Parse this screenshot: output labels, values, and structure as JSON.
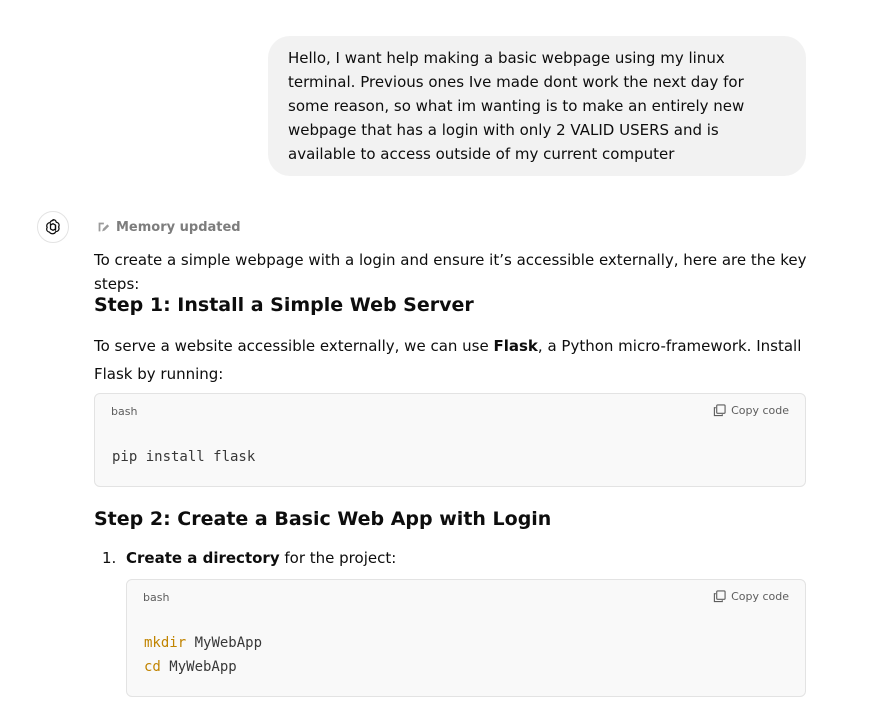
{
  "user_message": {
    "text": "Hello, I want help making a basic webpage using my linux terminal. Previous ones Ive made dont work the next day for some reason, so what im wanting is to make an entirely new webpage that has a login with only 2 VALID USERS and is available to access outside of my current computer"
  },
  "assistant": {
    "memory_label": "Memory updated",
    "intro": "To create a simple webpage with a login and ensure it’s accessible externally, here are the key steps:",
    "step1": {
      "heading": "Step 1: Install a Simple Web Server",
      "para_before": "To serve a website accessible externally, we can use ",
      "para_bold": "Flask",
      "para_after": ", a Python micro-framework. Install Flask by running:",
      "code": {
        "language": "bash",
        "copy_label": "Copy code",
        "line1": "pip install flask"
      }
    },
    "step2": {
      "heading": "Step 2: Create a Basic Web App with Login",
      "item1": {
        "number": "1.",
        "bold": "Create a directory",
        "rest": " for the project:"
      },
      "code": {
        "language": "bash",
        "copy_label": "Copy code",
        "line1_cmd": "mkdir",
        "line1_arg": " MyWebApp",
        "line2_cmd": "cd",
        "line2_arg": " MyWebApp"
      }
    }
  },
  "icons": {
    "avatar": "openai-logo-icon",
    "memory": "memory-pencil-icon",
    "copy": "copy-icon"
  }
}
